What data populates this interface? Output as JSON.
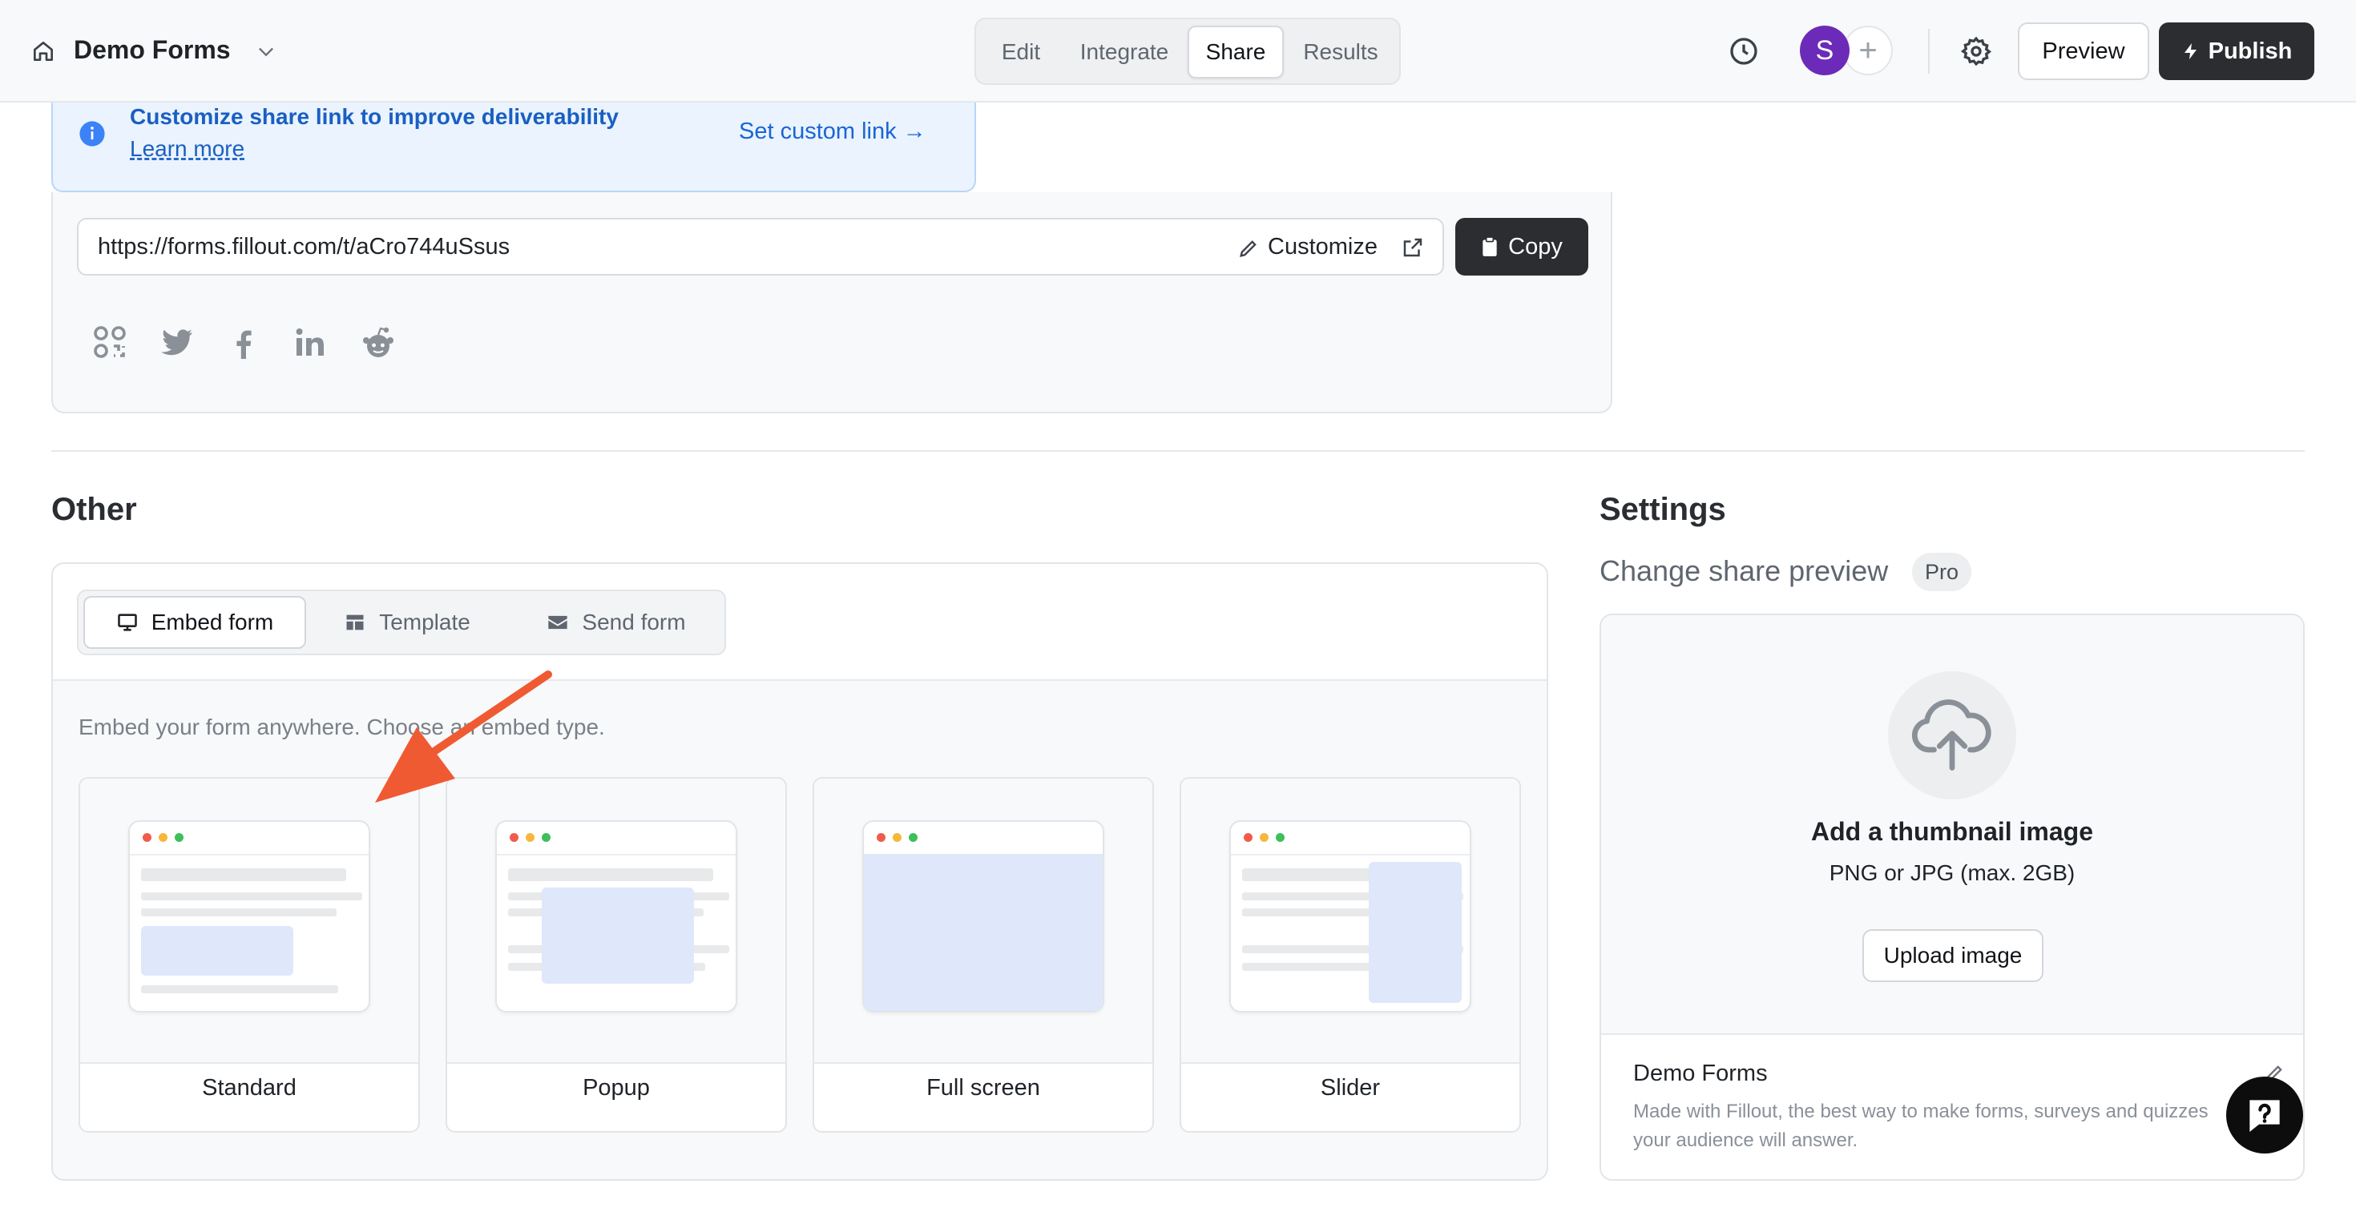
{
  "header": {
    "app_title": "Demo Forms",
    "tabs": [
      {
        "label": "Edit",
        "active": false
      },
      {
        "label": "Integrate",
        "active": false
      },
      {
        "label": "Share",
        "active": true
      },
      {
        "label": "Results",
        "active": false
      }
    ],
    "avatar_initial": "S",
    "avatar_color": "#6b2bb8",
    "add_label": "+",
    "preview_label": "Preview",
    "publish_label": "Publish"
  },
  "banner": {
    "title": "Customize share link to improve deliverability",
    "learn_more": "Learn more",
    "set_custom_link": "Set custom link →"
  },
  "share": {
    "url": "https://forms.fillout.com/t/aCro744uSsus",
    "customize_label": "Customize",
    "copy_label": "Copy",
    "social_icons": [
      "qr-code-icon",
      "twitter-icon",
      "facebook-icon",
      "linkedin-icon",
      "reddit-icon"
    ]
  },
  "other": {
    "title": "Other",
    "subtabs": [
      {
        "label": "Embed form",
        "icon": "monitor-icon",
        "active": true
      },
      {
        "label": "Template",
        "icon": "layout-icon",
        "active": false
      },
      {
        "label": "Send form",
        "icon": "mail-icon",
        "active": false
      }
    ],
    "hint": "Embed your form anywhere. Choose an embed type.",
    "embed_types": [
      {
        "label": "Standard"
      },
      {
        "label": "Popup"
      },
      {
        "label": "Full screen"
      },
      {
        "label": "Slider"
      }
    ]
  },
  "settings": {
    "title": "Settings",
    "subtitle": "Change share preview",
    "badge": "Pro",
    "thumbnail_title": "Add a thumbnail image",
    "thumbnail_sub": "PNG or JPG (max. 2GB)",
    "upload_label": "Upload image",
    "og_title": "Demo Forms",
    "og_description": "Made with Fillout, the best way to make forms, surveys and quizzes your audience will answer."
  },
  "colors": {
    "accent_link": "#1a65d4",
    "dark_button": "#2b2d30",
    "annotation_arrow": "#f05a33"
  }
}
